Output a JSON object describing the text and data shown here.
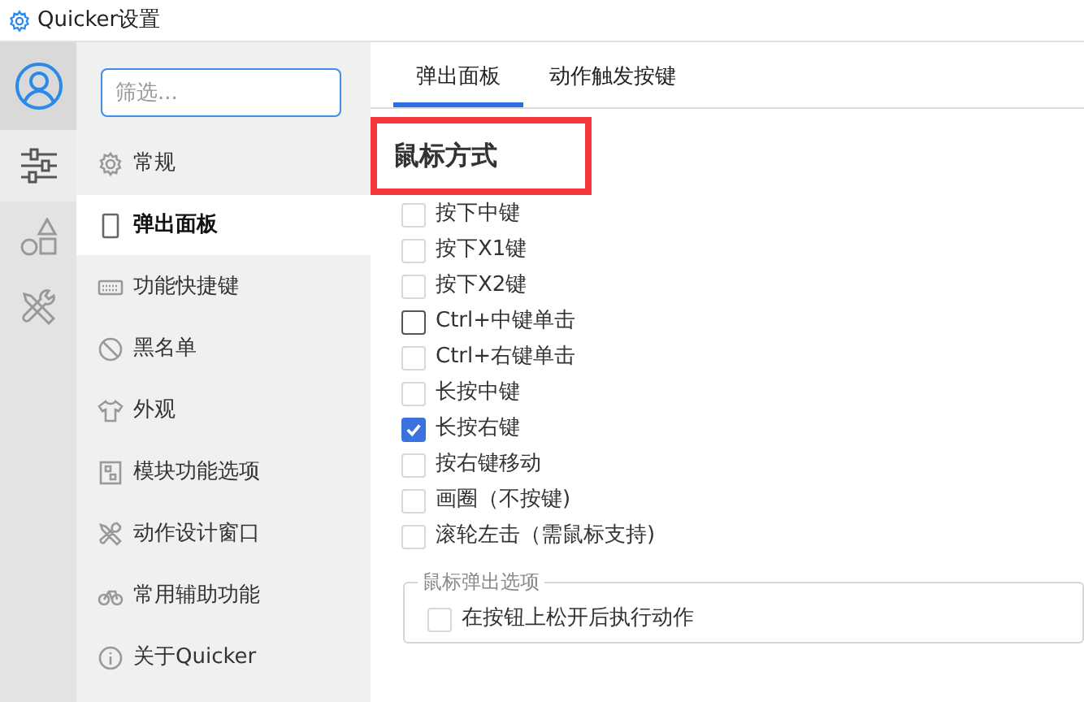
{
  "window": {
    "title": "Quicker设置"
  },
  "filter": {
    "placeholder": "筛选..."
  },
  "nav": [
    {
      "label": "常规",
      "selected": false
    },
    {
      "label": "弹出面板",
      "selected": true
    },
    {
      "label": "功能快捷键",
      "selected": false
    },
    {
      "label": "黑名单",
      "selected": false
    },
    {
      "label": "外观",
      "selected": false
    },
    {
      "label": "模块功能选项",
      "selected": false
    },
    {
      "label": "动作设计窗口",
      "selected": false
    },
    {
      "label": "常用辅助功能",
      "selected": false
    },
    {
      "label": "关于Quicker",
      "selected": false
    }
  ],
  "tabs": [
    {
      "label": "弹出面板",
      "selected": true
    },
    {
      "label": "动作触发按键",
      "selected": false
    }
  ],
  "section_title": "鼠标方式",
  "options": [
    {
      "label": "按下中键",
      "checked": false,
      "hovered": false
    },
    {
      "label": "按下X1键",
      "checked": false,
      "hovered": false
    },
    {
      "label": "按下X2键",
      "checked": false,
      "hovered": false
    },
    {
      "label": "Ctrl+中键单击",
      "checked": false,
      "hovered": true
    },
    {
      "label": "Ctrl+右键单击",
      "checked": false,
      "hovered": false
    },
    {
      "label": "长按中键",
      "checked": false,
      "hovered": false
    },
    {
      "label": "长按右键",
      "checked": true,
      "hovered": false
    },
    {
      "label": "按右键移动",
      "checked": false,
      "hovered": false
    },
    {
      "label": "画圈（不按键)",
      "checked": false,
      "hovered": false
    },
    {
      "label": "滚轮左击（需鼠标支持)",
      "checked": false,
      "hovered": false
    }
  ],
  "popup_group": {
    "title": "鼠标弹出选项",
    "options": [
      {
        "label": "在按钮上松开后执行动作",
        "checked": false,
        "hovered": false
      }
    ]
  }
}
